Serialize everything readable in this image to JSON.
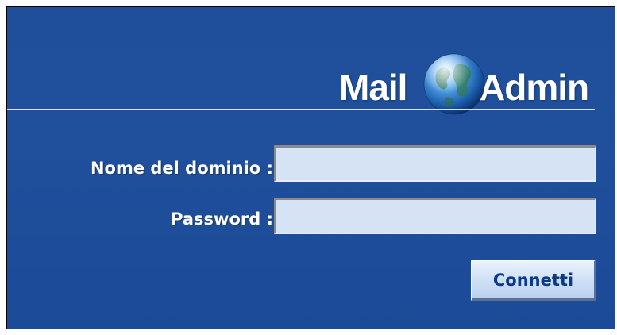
{
  "logo": {
    "part1": "Mail",
    "part2": "Admin",
    "icon": "globe-icon"
  },
  "form": {
    "domain_label": "Nome del dominio :",
    "domain_value": "",
    "password_label": "Password :",
    "password_value": "",
    "submit_label": "Connetti"
  },
  "colors": {
    "background": "#1f4f9a",
    "input_bg": "#d6e3f5",
    "button_text": "#0c3a86"
  }
}
